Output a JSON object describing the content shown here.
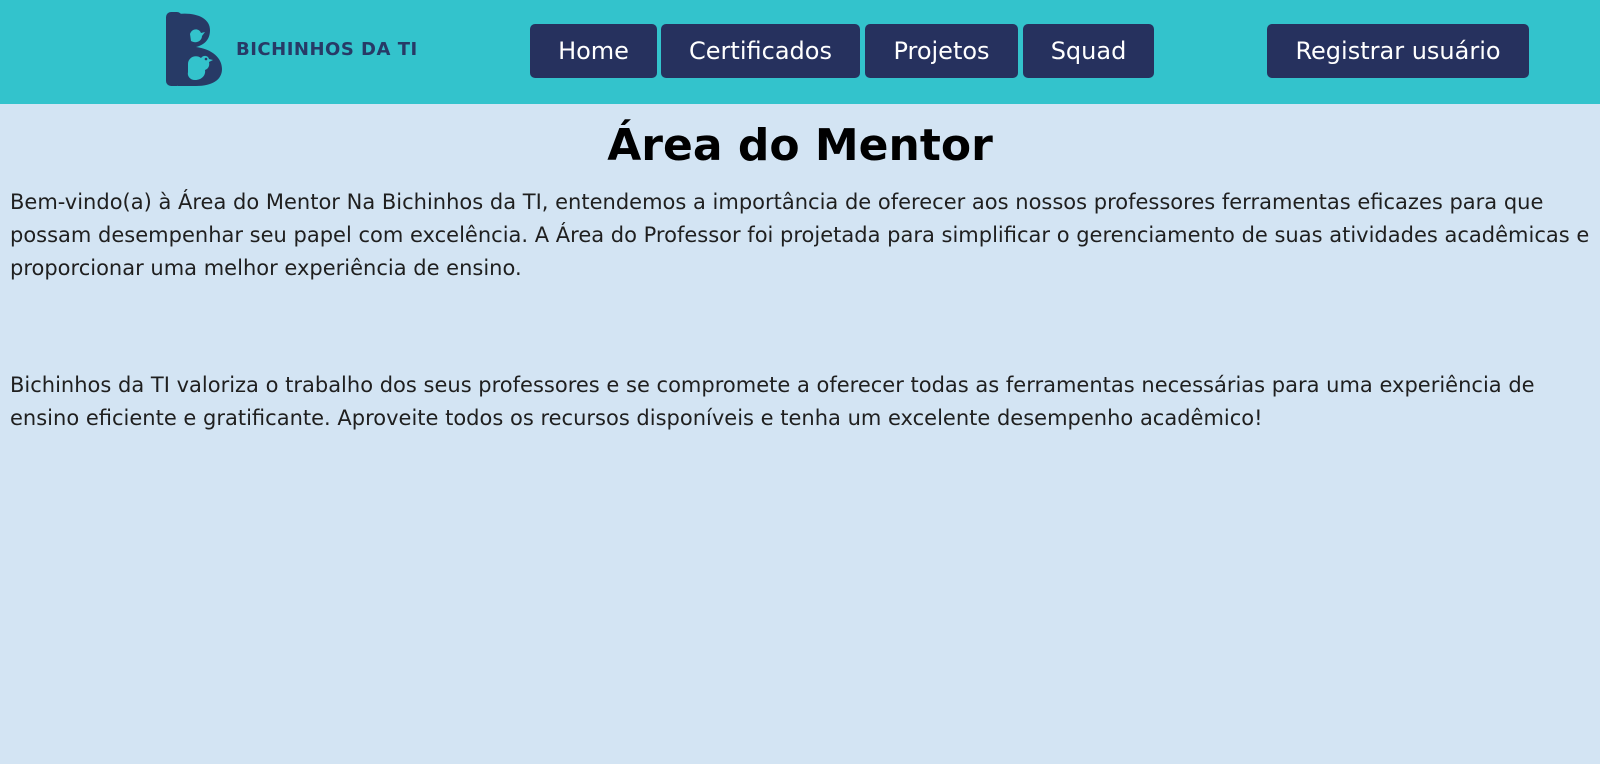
{
  "brand": {
    "name": "BICHINHOS DA TI",
    "logo_icon": "bichinhos-logo-icon",
    "colors": {
      "header_bg": "#33c3cc",
      "button_bg": "#26315e",
      "page_bg": "#d3e4f3",
      "logo_color": "#273a66"
    }
  },
  "nav": {
    "items": [
      {
        "label": "Home"
      },
      {
        "label": "Certificados"
      },
      {
        "label": "Projetos"
      },
      {
        "label": "Squad"
      }
    ],
    "register_label": "Registrar usuário"
  },
  "main": {
    "title": "Área do Mentor",
    "paragraphs": [
      "Bem-vindo(a) à Área do Mentor Na Bichinhos da TI, entendemos a importância de oferecer aos nossos professores ferramentas eficazes para que possam desempenhar seu papel com excelência. A Área do Professor foi projetada para simplificar o gerenciamento de suas atividades acadêmicas e proporcionar uma melhor experiência de ensino.",
      "Bichinhos da TI valoriza o trabalho dos seus professores e se compromete a oferecer todas as ferramentas necessárias para uma experiência de ensino eficiente e gratificante. Aproveite todos os recursos disponíveis e tenha um excelente desempenho acadêmico!"
    ]
  }
}
